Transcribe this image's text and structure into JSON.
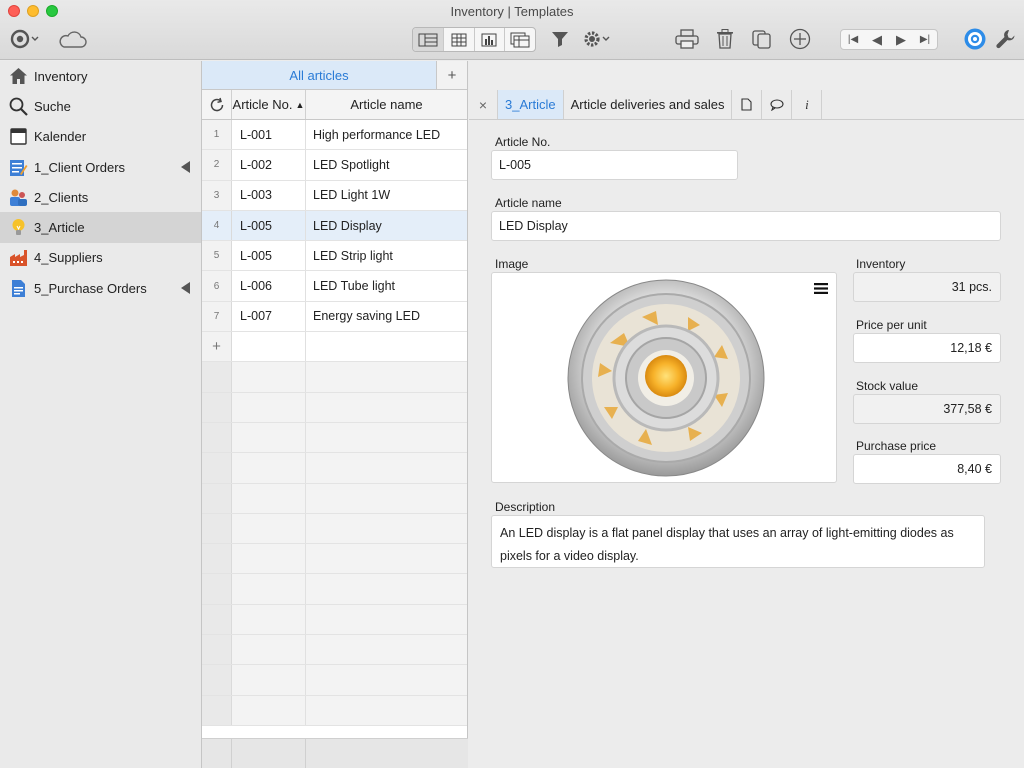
{
  "window": {
    "title": "Inventory | Templates"
  },
  "sidebar": {
    "items": [
      {
        "label": "Inventory",
        "icon": "home-icon"
      },
      {
        "label": "Suche",
        "icon": "search-icon"
      },
      {
        "label": "Kalender",
        "icon": "calendar-icon"
      },
      {
        "label": "1_Client Orders",
        "icon": "form-icon"
      },
      {
        "label": "2_Clients",
        "icon": "people-icon"
      },
      {
        "label": "3_Article",
        "icon": "lightbulb-icon"
      },
      {
        "label": "4_Suppliers",
        "icon": "factory-icon"
      },
      {
        "label": "5_Purchase Orders",
        "icon": "document-icon"
      }
    ]
  },
  "list": {
    "tab_label": "All articles",
    "add_tab": "+",
    "col_article_no": "Article No.",
    "col_article_name": "Article name",
    "add_row": "+",
    "rows": [
      {
        "n": "1",
        "no": "L-001",
        "name": "High performance LED"
      },
      {
        "n": "2",
        "no": "L-002",
        "name": "LED Spotlight"
      },
      {
        "n": "3",
        "no": "L-003",
        "name": "LED Light 1W"
      },
      {
        "n": "4",
        "no": "L-005",
        "name": "LED Display"
      },
      {
        "n": "5",
        "no": "L-005",
        "name": "LED Strip light"
      },
      {
        "n": "6",
        "no": "L-006",
        "name": "LED Tube light"
      },
      {
        "n": "7",
        "no": "L-007",
        "name": "Energy saving LED"
      }
    ]
  },
  "detail": {
    "close": "×",
    "tab_article": "3_Article",
    "tab_deliveries": "Article deliveries and sales",
    "tab_info": "i",
    "article_no_label": "Article No.",
    "article_no": "L-005",
    "article_name_label": "Article name",
    "article_name": "LED Display",
    "image_label": "Image",
    "inventory_label": "Inventory",
    "inventory": "31 pcs.",
    "price_label": "Price per unit",
    "price": "12,18 €",
    "stock_label": "Stock value",
    "stock": "377,58 €",
    "purchase_label": "Purchase price",
    "purchase": "8,40 €",
    "description_label": "Description",
    "description": "An LED display is a flat panel display that uses an array of light-emitting diodes as pixels for a video display."
  }
}
